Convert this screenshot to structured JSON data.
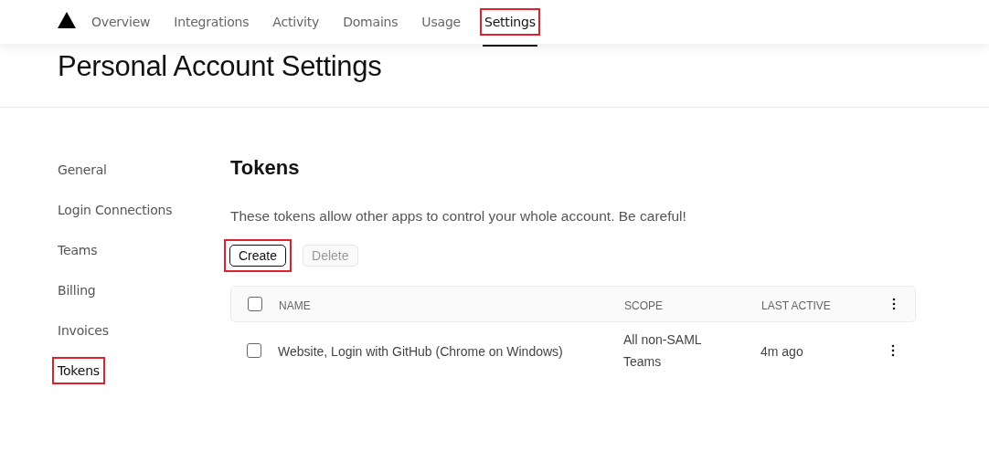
{
  "nav": {
    "items": [
      {
        "label": "Overview",
        "selected": false,
        "highlighted": false
      },
      {
        "label": "Integrations",
        "selected": false,
        "highlighted": false
      },
      {
        "label": "Activity",
        "selected": false,
        "highlighted": false
      },
      {
        "label": "Domains",
        "selected": false,
        "highlighted": false
      },
      {
        "label": "Usage",
        "selected": false,
        "highlighted": false
      },
      {
        "label": "Settings",
        "selected": true,
        "highlighted": true
      }
    ]
  },
  "page_title": "Personal Account Settings",
  "sidebar": {
    "items": [
      {
        "label": "General",
        "selected": false,
        "highlighted": false
      },
      {
        "label": "Login Connections",
        "selected": false,
        "highlighted": false
      },
      {
        "label": "Teams",
        "selected": false,
        "highlighted": false
      },
      {
        "label": "Billing",
        "selected": false,
        "highlighted": false
      },
      {
        "label": "Invoices",
        "selected": false,
        "highlighted": false
      },
      {
        "label": "Tokens",
        "selected": true,
        "highlighted": true
      }
    ]
  },
  "section": {
    "title": "Tokens",
    "description": "These tokens allow other apps to control your whole account. Be careful!",
    "buttons": [
      {
        "label": "Create",
        "disabled": false,
        "highlighted": true
      },
      {
        "label": "Delete",
        "disabled": true,
        "highlighted": false
      }
    ]
  },
  "table": {
    "select_all_checked": false,
    "columns": [
      "NAME",
      "SCOPE",
      "LAST ACTIVE"
    ],
    "rows": [
      {
        "checked": false,
        "name": "Website, Login with GitHub (Chrome on Windows)",
        "scope": [
          "All non-SAML",
          "Teams"
        ],
        "last_active": "4m ago"
      }
    ]
  }
}
